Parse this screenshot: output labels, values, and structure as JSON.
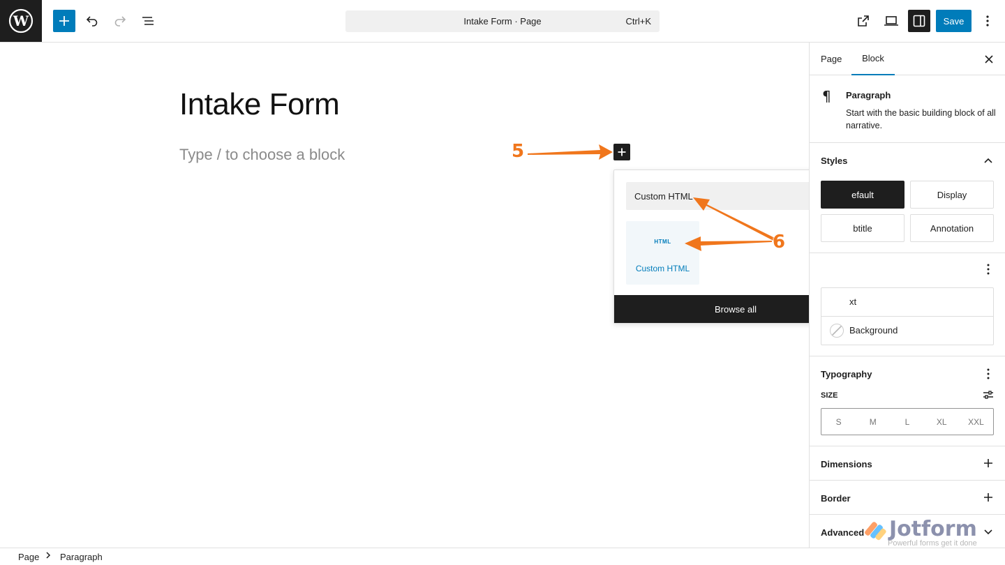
{
  "topbar": {
    "document_title": "Intake Form · Page",
    "shortcut": "Ctrl+K",
    "save_label": "Save"
  },
  "canvas": {
    "post_title": "Intake Form",
    "paragraph_placeholder": "Type / to choose a block"
  },
  "inserter": {
    "search_value": "Custom HTML",
    "result_icon_text": "HTML",
    "result_label": "Custom HTML",
    "browse_all_label": "Browse all"
  },
  "sidebar": {
    "tabs": [
      {
        "label": "Page"
      },
      {
        "label": "Block"
      }
    ],
    "block_card": {
      "title": "Paragraph",
      "description": "Start with the basic building block of all narrative."
    },
    "styles": {
      "heading": "Styles",
      "options": [
        {
          "label": "efault"
        },
        {
          "label": "Display"
        },
        {
          "label": "btitle"
        },
        {
          "label": "Annotation"
        }
      ]
    },
    "color": {
      "text_label": "xt",
      "background_label": "Background"
    },
    "typography": {
      "heading": "Typography",
      "size_label": "SIZE",
      "sizes": [
        "S",
        "M",
        "L",
        "XL",
        "XXL"
      ]
    },
    "panels": {
      "dimensions": "Dimensions",
      "border": "Border",
      "advanced": "Advanced"
    }
  },
  "breadcrumb": [
    "Page",
    "Paragraph"
  ],
  "annotations": {
    "step_5": "5",
    "step_6": "6"
  },
  "watermark": {
    "word": "Jotform",
    "tagline": "Powerful forms get it done"
  },
  "colors": {
    "accent": "#007cba",
    "dark": "#1e1e1e",
    "annotation": "#f0761c"
  }
}
